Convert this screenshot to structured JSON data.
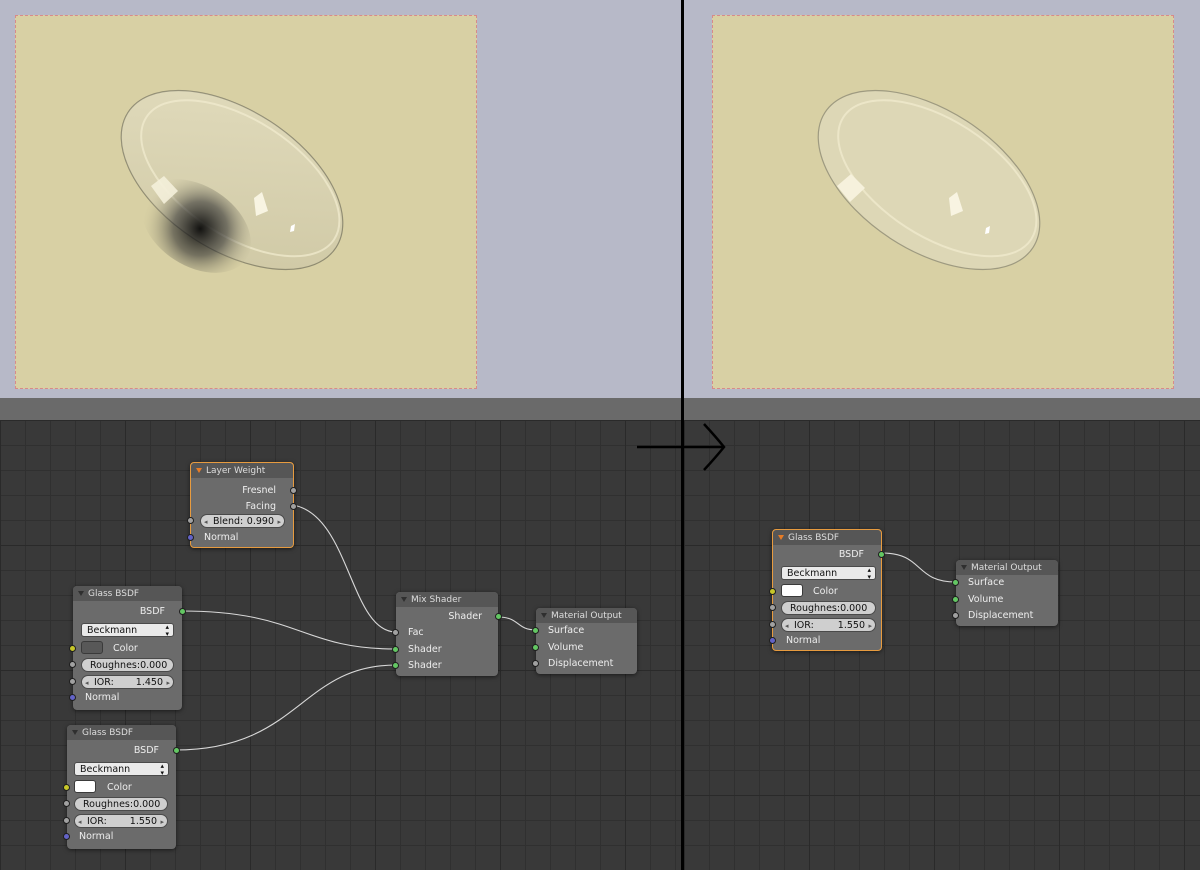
{
  "colors": {
    "render_bg": "#d8d0a4",
    "viewport_bg": "#b7b9c8",
    "editor_bg": "#393939",
    "node_bg": "#6b6b6b",
    "selected_outline": "#e79b3f",
    "socket_shader": "#63c763",
    "socket_float": "#a1a1a1",
    "socket_color": "#c7c729",
    "socket_vector": "#6363c7"
  },
  "left": {
    "layer_weight": {
      "title": "Layer Weight",
      "outputs": [
        "Fresnel",
        "Facing"
      ],
      "blend_label": "Blend:",
      "blend_value": "0.990",
      "normal_label": "Normal"
    },
    "glass1": {
      "title": "Glass BSDF",
      "output": "BSDF",
      "distribution": "Beckmann",
      "color_label": "Color",
      "color": "#585858",
      "roughness_label": "Roughnes:",
      "roughness_value": "0.000",
      "ior_label": "IOR:",
      "ior_value": "1.450",
      "normal_label": "Normal"
    },
    "glass2": {
      "title": "Glass BSDF",
      "output": "BSDF",
      "distribution": "Beckmann",
      "color_label": "Color",
      "color": "#ffffff",
      "roughness_label": "Roughnes:",
      "roughness_value": "0.000",
      "ior_label": "IOR:",
      "ior_value": "1.550",
      "normal_label": "Normal"
    },
    "mix_shader": {
      "title": "Mix Shader",
      "output": "Shader",
      "inputs": [
        "Fac",
        "Shader",
        "Shader"
      ]
    },
    "material_output": {
      "title": "Material Output",
      "inputs": [
        "Surface",
        "Volume",
        "Displacement"
      ]
    }
  },
  "right": {
    "glass": {
      "title": "Glass BSDF",
      "output": "BSDF",
      "distribution": "Beckmann",
      "color_label": "Color",
      "color": "#ffffff",
      "roughness_label": "Roughnes:",
      "roughness_value": "0.000",
      "ior_label": "IOR:",
      "ior_value": "1.550",
      "normal_label": "Normal"
    },
    "material_output": {
      "title": "Material Output",
      "inputs": [
        "Surface",
        "Volume",
        "Displacement"
      ]
    }
  }
}
